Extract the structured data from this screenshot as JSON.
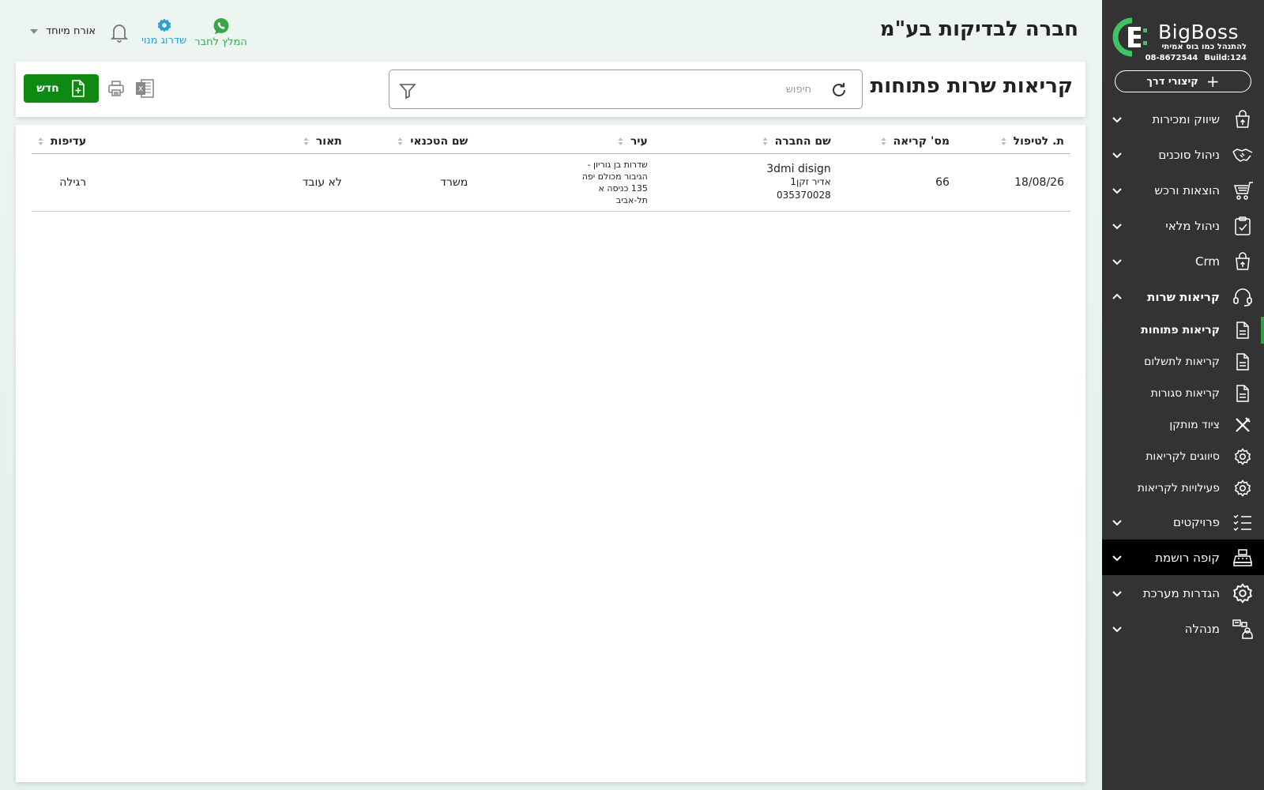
{
  "app": {
    "logo_name": "BigBoss",
    "tagline": "להתנהל כמו בוס אמיתי",
    "phone": "08-8672544",
    "build": "Build:124",
    "shortcuts_label": "קיצורי דרך"
  },
  "sidebar": {
    "items": [
      {
        "label": "שיווק ומכירות",
        "icon": "shopping-bag-icon"
      },
      {
        "label": "ניהול סוכנים",
        "icon": "handshake-icon"
      },
      {
        "label": "הוצאות ורכש",
        "icon": "cart-icon"
      },
      {
        "label": "ניהול מלאי",
        "icon": "clipboard-check-icon"
      },
      {
        "label": "Crm",
        "icon": "shopping-bag-icon"
      },
      {
        "label": "קריאות שרות",
        "icon": "headset-icon"
      },
      {
        "label": "פרויקטים",
        "icon": "checklist-icon"
      },
      {
        "label": "קופה רושמת",
        "icon": "cash-register-icon"
      },
      {
        "label": "הגדרות מערכת",
        "icon": "gear-icon"
      },
      {
        "label": "מנהלה",
        "icon": "admin-icon"
      }
    ],
    "subitems": [
      {
        "label": "קריאות פתוחות",
        "icon": "document-icon"
      },
      {
        "label": "קריאות לתשלום",
        "icon": "document-icon"
      },
      {
        "label": "קריאות סגורות",
        "icon": "document-icon"
      },
      {
        "label": "ציוד מותקן",
        "icon": "tools-icon"
      },
      {
        "label": "סיווגים לקריאות",
        "icon": "gear-icon"
      },
      {
        "label": "פעילויות לקריאות",
        "icon": "gear-icon"
      }
    ]
  },
  "header": {
    "company": "חברה לבדיקות בע\"מ",
    "user": "אורח מיוחד",
    "upgrade_label": "שדרוג מנוי",
    "refer_label": "המלץ לחבר"
  },
  "toolbar": {
    "title": "קריאות שרות פתוחות",
    "search_placeholder": "חיפוש",
    "new_label": "חדש"
  },
  "table": {
    "columns": [
      "ת. לטיפול",
      "מס' קריאה",
      "שם החברה",
      "עיר",
      "שם הטכנאי",
      "תאור",
      "עדיפות"
    ],
    "rows": [
      {
        "date": "18/08/26",
        "number": "66",
        "company": "3dmi disign",
        "contact": "אדיר זקן1",
        "phone": "035370028",
        "city_lines": [
          "שדרות בן גוריון  -",
          "הגיבור מכולם יפה",
          "135 כניסה א",
          "תל-אביב"
        ],
        "technician": "משרד",
        "description": "לא עובד",
        "priority": "רגילה"
      }
    ]
  },
  "colors": {
    "sidebar_bg": "#333333",
    "active_accent": "#3a9c4a",
    "new_button": "#0e8a12",
    "upgrade_link": "#2a9fd6",
    "refer_link": "#3aa64a"
  }
}
